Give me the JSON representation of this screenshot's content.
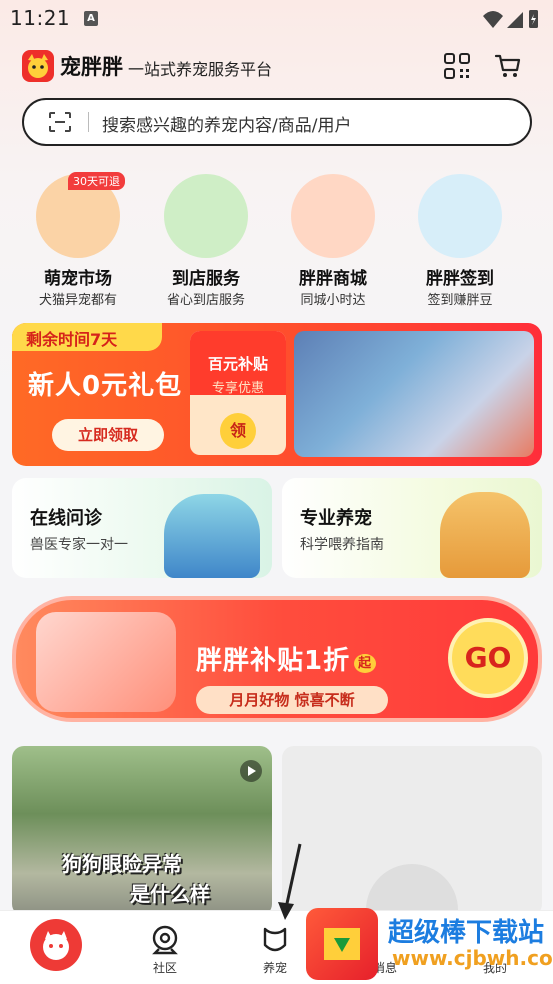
{
  "status_bar": {
    "time": "11:21",
    "indicator": "A"
  },
  "header": {
    "brand": "宠胖胖",
    "slogan": "一站式养宠服务平台"
  },
  "search": {
    "placeholder": "搜索感兴趣的养宠内容/商品/用户"
  },
  "categories": [
    {
      "title": "萌宠市场",
      "subtitle": "犬猫异宠都有",
      "badge": "30天可退",
      "color": "#fbd3a6"
    },
    {
      "title": "到店服务",
      "subtitle": "省心到店服务",
      "color": "#cfeec6"
    },
    {
      "title": "胖胖商城",
      "subtitle": "同城小时达",
      "color": "#ffd7c4"
    },
    {
      "title": "胖胖签到",
      "subtitle": "签到赚胖豆",
      "color": "#d7eef9"
    }
  ],
  "promo": {
    "time_tag": "剩余时间7天",
    "title": "新人0元礼包",
    "button": "立即领取",
    "coupon_title": "百元补贴",
    "coupon_sub": "专享优惠",
    "coupon_button": "领"
  },
  "cards": [
    {
      "title": "在线问诊",
      "subtitle": "兽医专家一对一"
    },
    {
      "title": "专业养宠",
      "subtitle": "科学喂养指南"
    }
  ],
  "banner": {
    "title": "胖胖补贴1折",
    "title_tag": "起",
    "subtitle": "月月好物 惊喜不断",
    "go": "GO"
  },
  "feed": [
    {
      "line1": "狗狗眼睑异常",
      "line2": "是什么样"
    }
  ],
  "tabbar": {
    "items": [
      {
        "label": ""
      },
      {
        "label": "社区"
      },
      {
        "label": "养宠"
      },
      {
        "label": "消息"
      },
      {
        "label": "我的"
      }
    ]
  },
  "watermark": {
    "text": "超级棒下载站",
    "url": "www.cjbwh.com"
  },
  "colors": {
    "brand_red": "#ee2f2a",
    "accent_orange": "#ff6a25"
  }
}
